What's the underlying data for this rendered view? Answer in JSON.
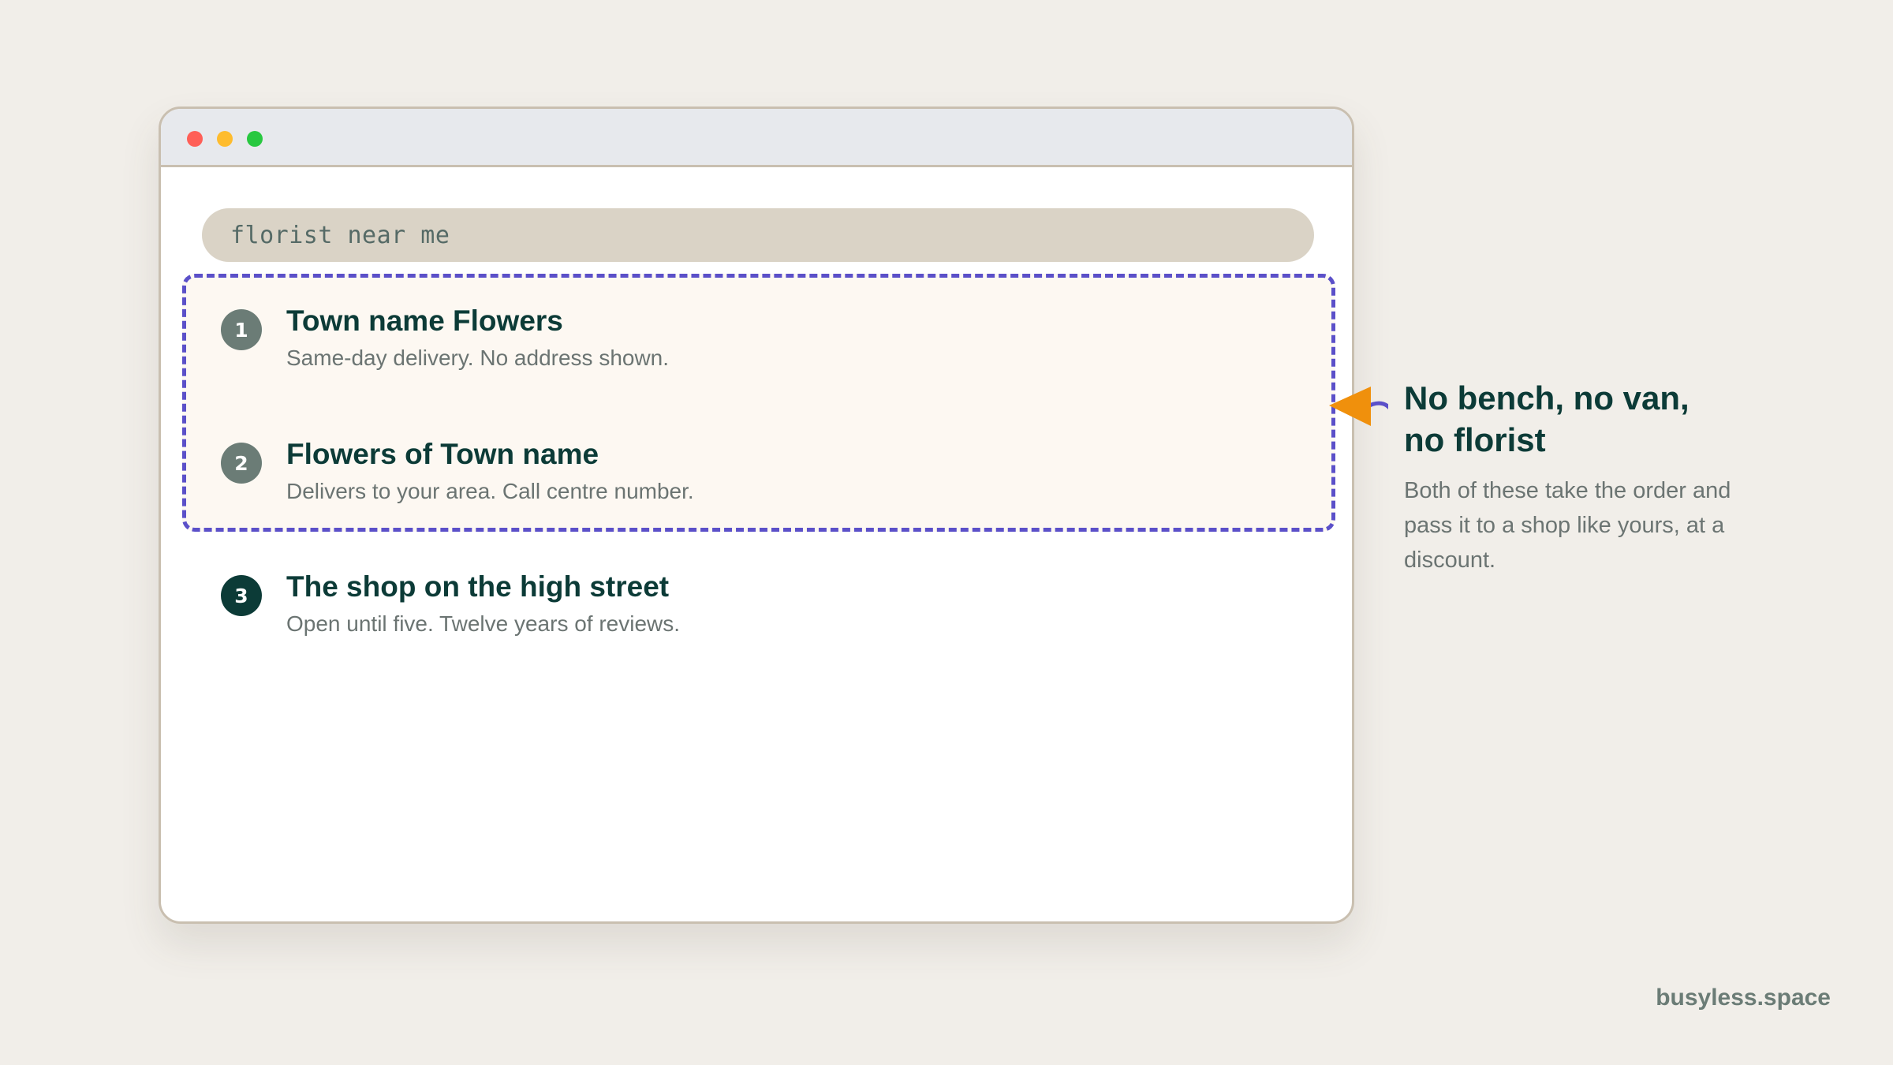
{
  "search": {
    "query": "florist near me"
  },
  "results": [
    {
      "number": "1",
      "title": "Town name Flowers",
      "description": "Same-day delivery. No address shown."
    },
    {
      "number": "2",
      "title": "Flowers of Town name",
      "description": "Delivers to your area. Call centre number."
    },
    {
      "number": "3",
      "title": "The shop on the high street",
      "description": "Open until five. Twelve years of reviews."
    }
  ],
  "annotation": {
    "heading": "No bench, no van, no florist",
    "body": "Both of these take the order and pass it to a shop like yours, at a discount."
  },
  "footer": {
    "site": "busyless.space"
  },
  "colors": {
    "background": "#f1eee9",
    "accent_dark": "#0c3b37",
    "highlight_border": "#5b50c9",
    "arrow": "#f0900c",
    "search_bar": "#dad3c6"
  }
}
